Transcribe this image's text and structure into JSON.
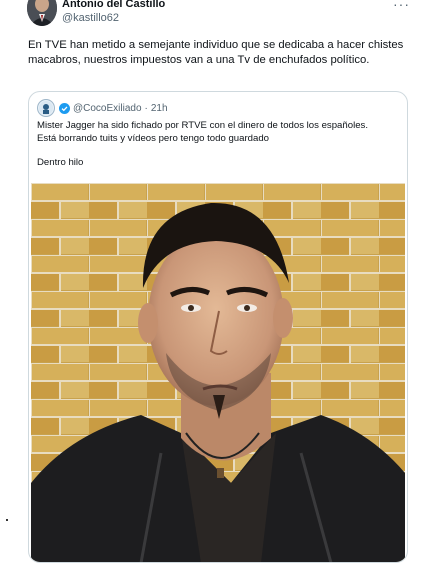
{
  "tweet": {
    "author_name": "Antonio del Castillo",
    "author_handle": "@kastillo62",
    "text": "En TVE han metido a semejante individuo que se dedicaba a hacer chistes macabros, nuestros impuestos van a una Tv de enchufados político."
  },
  "quote": {
    "handle": "@CocoExiliado",
    "separator": "·",
    "time": "21h",
    "line1": "Mister Jagger ha sido fichado por RTVE con el dinero de todos los españoles.",
    "line2": "Está borrando tuits y vídeos pero tengo todo guardado",
    "line3": "Dentro hilo"
  },
  "icons": {
    "more": "more-options-icon",
    "verified": "verified-badge-icon"
  },
  "colors": {
    "text": "#0f1419",
    "secondary": "#536471",
    "verified": "#1d9bf0",
    "border": "#cfd9de"
  }
}
